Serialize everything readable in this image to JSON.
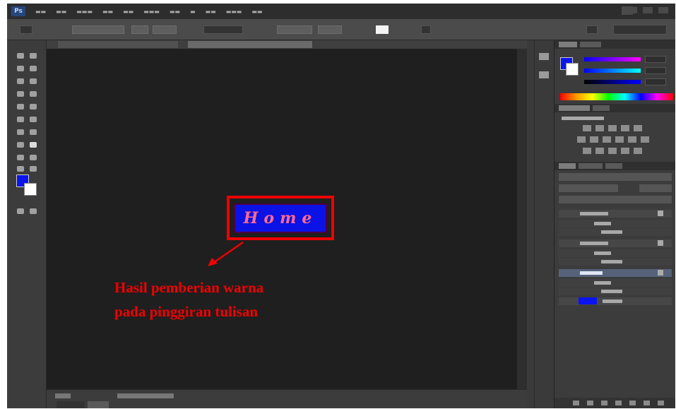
{
  "canvas": {
    "home_button_label": "Home"
  },
  "annotation": {
    "line1": "Hasil pemberian warna",
    "line2": "pada pinggiran tulisan"
  },
  "colors": {
    "annotation": "#f00000",
    "home_background": "#0b12e6",
    "home_text": "#ff6a8e",
    "foreground_color": "#0a14f0",
    "background_color": "#ffffff",
    "canvas_background": "#1f1f1f",
    "app_chrome": "#3a3a3a"
  },
  "icons": {
    "app_logo": "photoshop-logo-icon",
    "arrow": "arrow-icon"
  }
}
